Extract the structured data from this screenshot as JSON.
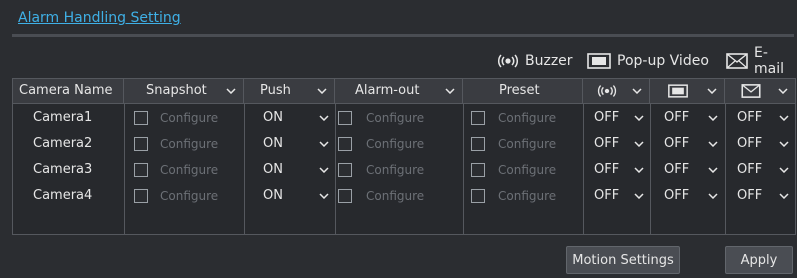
{
  "title": "Alarm Handling Setting",
  "legend": {
    "buzzer": "Buzzer",
    "popup": "Pop-up Video",
    "email": "E-mail"
  },
  "columns": {
    "camera_name": "Camera Name",
    "snapshot": "Snapshot",
    "push": "Push",
    "alarm_out": "Alarm-out",
    "preset": "Preset"
  },
  "configure_label": "Configure",
  "rows": [
    {
      "camera": "Camera1",
      "push": "ON",
      "buzzer": "OFF",
      "popup": "OFF",
      "email": "OFF"
    },
    {
      "camera": "Camera2",
      "push": "ON",
      "buzzer": "OFF",
      "popup": "OFF",
      "email": "OFF"
    },
    {
      "camera": "Camera3",
      "push": "ON",
      "buzzer": "OFF",
      "popup": "OFF",
      "email": "OFF"
    },
    {
      "camera": "Camera4",
      "push": "ON",
      "buzzer": "OFF",
      "popup": "OFF",
      "email": "OFF"
    }
  ],
  "buttons": {
    "motion_settings": "Motion Settings",
    "apply": "Apply"
  }
}
